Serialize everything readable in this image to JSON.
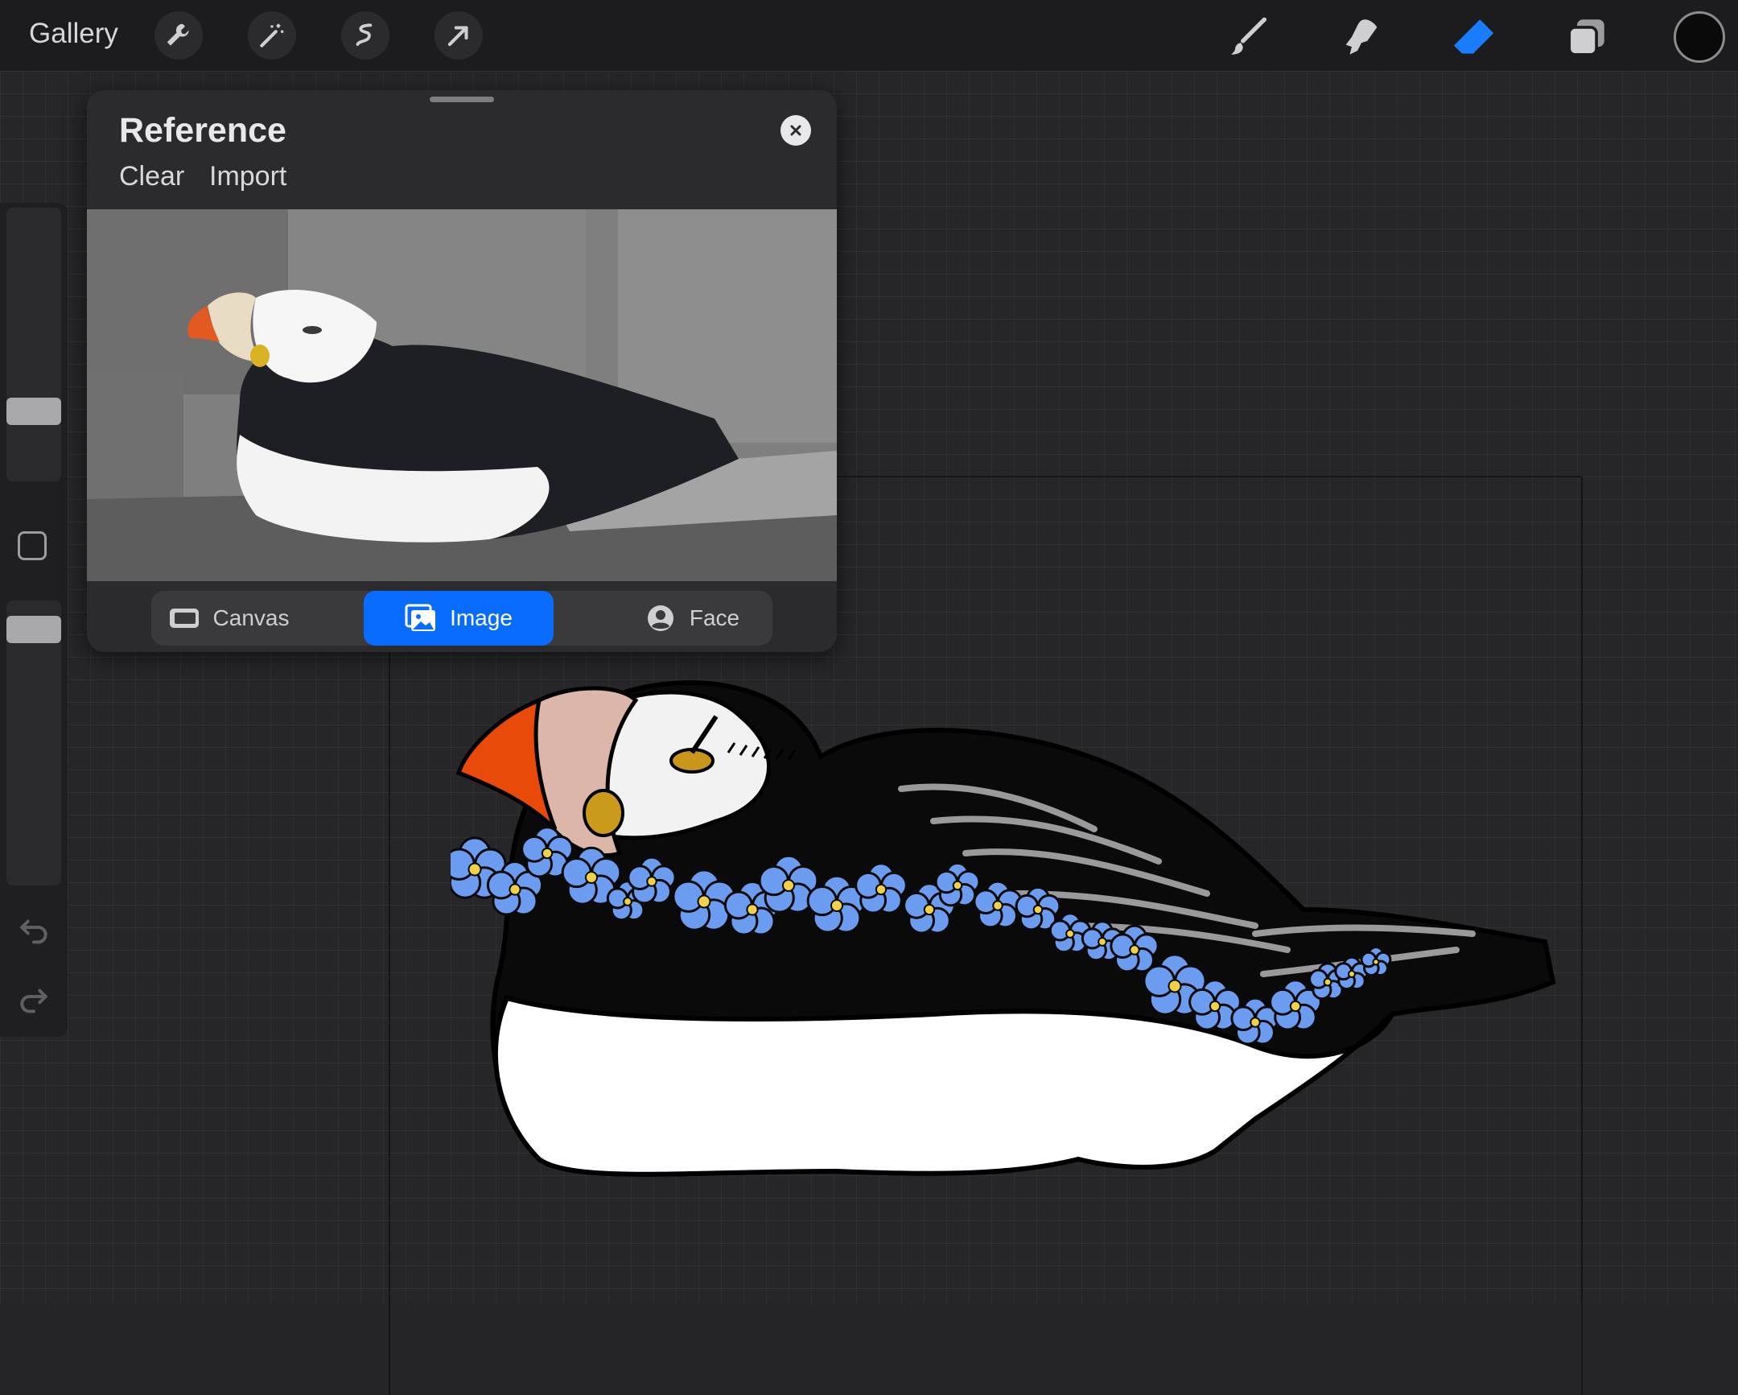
{
  "toolbar": {
    "gallery_label": "Gallery",
    "left_tools": [
      "wrench-icon",
      "magic-wand-icon",
      "selection-icon",
      "transform-arrow-icon"
    ],
    "right_tools": [
      "brush-icon",
      "smudge-icon",
      "eraser-icon",
      "layers-icon"
    ],
    "active_tool": "eraser-icon",
    "current_color": "#0a0a0a",
    "accent_color": "#0a6cff"
  },
  "sidebar": {
    "brush_size_level": 0.15,
    "opacity_level": 0.06
  },
  "reference": {
    "title": "Reference",
    "clear_label": "Clear",
    "import_label": "Import",
    "modes": [
      {
        "label": "Canvas",
        "icon": "canvas-icon"
      },
      {
        "label": "Image",
        "icon": "image-icon"
      },
      {
        "label": "Face",
        "icon": "face-icon"
      }
    ],
    "selected_mode": "Image"
  }
}
